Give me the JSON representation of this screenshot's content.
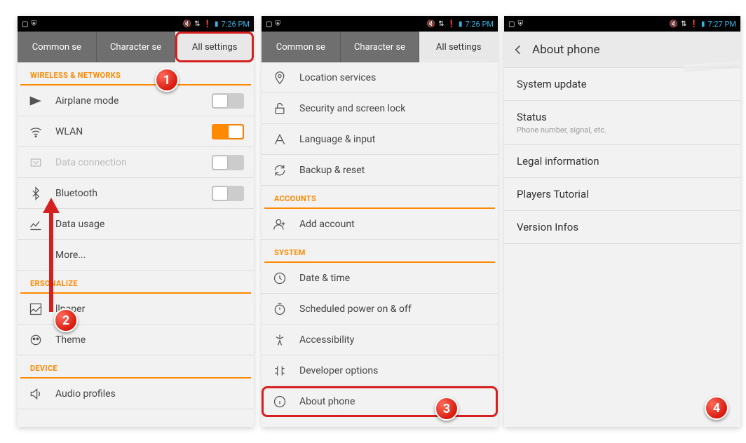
{
  "statusbar": {
    "time1": "7:26 PM",
    "time2": "7:26 PM",
    "time3": "7:27 PM"
  },
  "tabs": {
    "common": "Common se",
    "character": "Character se",
    "all": "All settings"
  },
  "s1": {
    "sec_wireless": "WIRELESS & NETWORKS",
    "airplane": "Airplane mode",
    "wlan": "WLAN",
    "data_conn": "Data connection",
    "bluetooth": "Bluetooth",
    "data_usage": "Data usage",
    "more": "More...",
    "sec_personalize": "ERSONALIZE",
    "wallpaper": "llpaper",
    "theme": "Theme",
    "sec_device": "DEVICE",
    "audio": "Audio profiles"
  },
  "s2": {
    "location": "Location services",
    "security": "Security and screen lock",
    "language": "Language & input",
    "backup": "Backup & reset",
    "sec_accounts": "ACCOUNTS",
    "add_account": "Add account",
    "sec_system": "SYSTEM",
    "datetime": "Date & time",
    "scheduled": "Scheduled power on & off",
    "accessibility": "Accessibility",
    "developer": "Developer options",
    "about": "About phone"
  },
  "s3": {
    "title": "About phone",
    "system_update": "System update",
    "status": "Status",
    "status_sub": "Phone number, signal, etc.",
    "legal": "Legal information",
    "players": "Players Tutorial",
    "version": "Version Infos"
  },
  "badges": {
    "b1": "1",
    "b2": "2",
    "b3": "3",
    "b4": "4"
  }
}
